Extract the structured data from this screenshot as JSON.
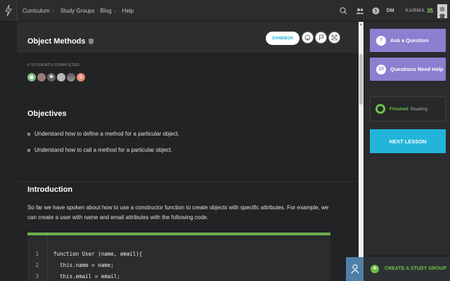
{
  "nav": {
    "items": [
      {
        "label": "Curriculum",
        "has_dropdown": true
      },
      {
        "label": "Study Groups",
        "has_dropdown": false
      },
      {
        "label": "Blog",
        "has_dropdown": true
      },
      {
        "label": "Help",
        "has_dropdown": false
      }
    ],
    "initials": "DM",
    "karma_label": "KARMA",
    "karma_value": "35"
  },
  "lesson": {
    "title": "Object Methods",
    "sandbox_label": "SANDBOX",
    "students_completed": "6 STUDENTS COMPLETED",
    "objectives_heading": "Objectives",
    "objectives": [
      "Understand how to define a method for a particular object.",
      "Understand how to call a method for a particular object."
    ],
    "intro_heading": "Introduction",
    "intro_text": "So far we have spoken about how to use a constructor function to create objects with specific attributes. For example, we can create a user with name and email attributes with the following code.",
    "code": [
      {
        "n": "1",
        "text": "function User (name, email){"
      },
      {
        "n": "2",
        "text": "  this.name = name;"
      },
      {
        "n": "3",
        "text": "  this.email = email;"
      }
    ]
  },
  "sidebar": {
    "ask_label": "Ask a Question",
    "ask_icon": "?",
    "help_label": "Questions Need Help",
    "help_count": "10",
    "finished_label": "Finished",
    "reading_label": "Reading",
    "next_label": "NEXT LESSON",
    "study_label": "CREATE A STUDY GROUP"
  },
  "colors": {
    "accent_purple": "#8b7fd0",
    "accent_cyan": "#23b5d9",
    "accent_green": "#6dc04a"
  }
}
